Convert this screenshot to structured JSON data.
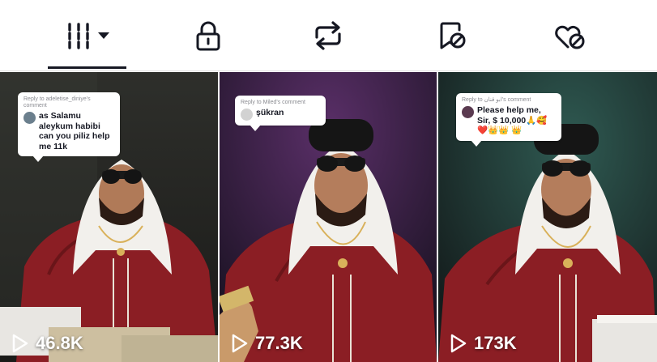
{
  "tabs": [
    {
      "name": "videos",
      "icon": "grid-icon",
      "selected": true,
      "has_dropdown": true
    },
    {
      "name": "private",
      "icon": "lock-icon",
      "selected": false
    },
    {
      "name": "reposts",
      "icon": "repost-icon",
      "selected": false
    },
    {
      "name": "saved",
      "icon": "bookmark-slash-icon",
      "selected": false
    },
    {
      "name": "liked",
      "icon": "heart-slash-icon",
      "selected": false
    }
  ],
  "videos": [
    {
      "reply_to": "Reply to adeletise_diniye's comment",
      "comment": "as Salamu aleykum habibi can you piliz help me 11k",
      "views": "46.8K"
    },
    {
      "reply_to": "Reply to Miled's comment",
      "comment": "şükran",
      "views": "77.3K"
    },
    {
      "reply_to": "Reply to ابو قنان's comment",
      "comment": "Please help me, Sir, $ 10,000🙏🥰❤️👑👑 👑",
      "views": "173K"
    }
  ],
  "colors": {
    "tab_icon": "#161823",
    "robe": "#8b1e24",
    "headscarf": "#f2f0ec",
    "view_text": "#ffffff"
  }
}
